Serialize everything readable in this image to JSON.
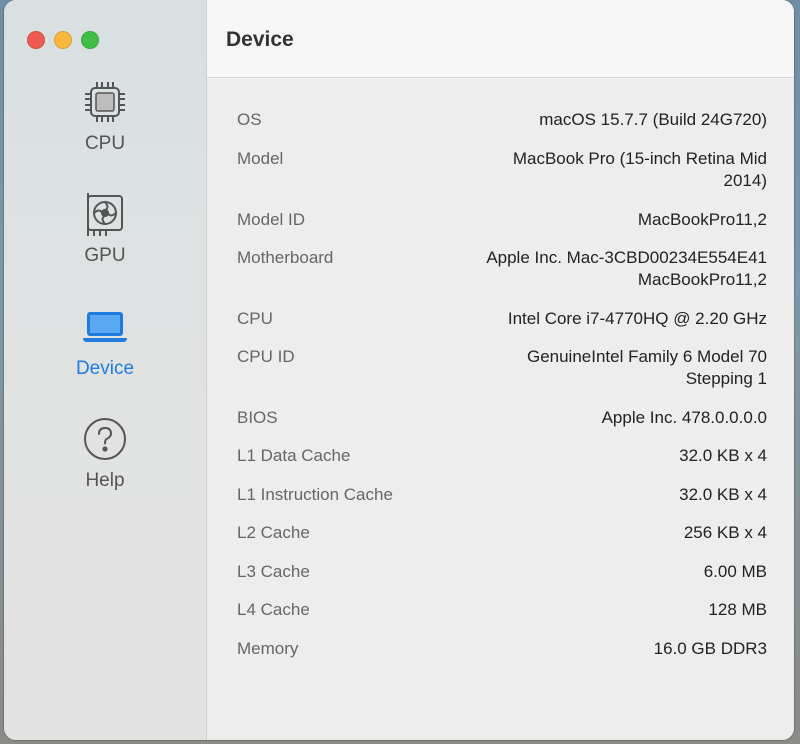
{
  "sidebar": {
    "items": [
      {
        "label": "CPU",
        "icon": "cpu-chip-icon"
      },
      {
        "label": "GPU",
        "icon": "gpu-card-icon"
      },
      {
        "label": "Device",
        "icon": "laptop-icon",
        "active": true
      },
      {
        "label": "Help",
        "icon": "question-circle-icon"
      }
    ]
  },
  "header": {
    "title": "Device"
  },
  "device_info": [
    {
      "key": "OS",
      "value": "macOS 15.7.7 (Build 24G720)"
    },
    {
      "key": "Model",
      "value": "MacBook Pro (15-inch Retina Mid 2014)"
    },
    {
      "key": "Model ID",
      "value": "MacBookPro11,2"
    },
    {
      "key": "Motherboard",
      "value": "Apple Inc. Mac-3CBD00234E554E41 MacBookPro11,2"
    },
    {
      "key": "CPU",
      "value": "Intel Core i7-4770HQ @ 2.20 GHz"
    },
    {
      "key": "CPU ID",
      "value": "GenuineIntel Family 6 Model 70 Stepping 1"
    },
    {
      "key": "BIOS",
      "value": "Apple Inc. 478.0.0.0.0"
    },
    {
      "key": "L1 Data Cache",
      "value": "32.0 KB x 4"
    },
    {
      "key": "L1 Instruction Cache",
      "value": "32.0 KB x 4"
    },
    {
      "key": "L2 Cache",
      "value": "256 KB x 4"
    },
    {
      "key": "L3 Cache",
      "value": "6.00 MB"
    },
    {
      "key": "L4 Cache",
      "value": "128 MB"
    },
    {
      "key": "Memory",
      "value": "16.0 GB DDR3"
    }
  ],
  "colors": {
    "accent": "#1f7bde",
    "close": "#ee5b53",
    "minimize": "#f5b83a",
    "maximize": "#3fbf48"
  }
}
